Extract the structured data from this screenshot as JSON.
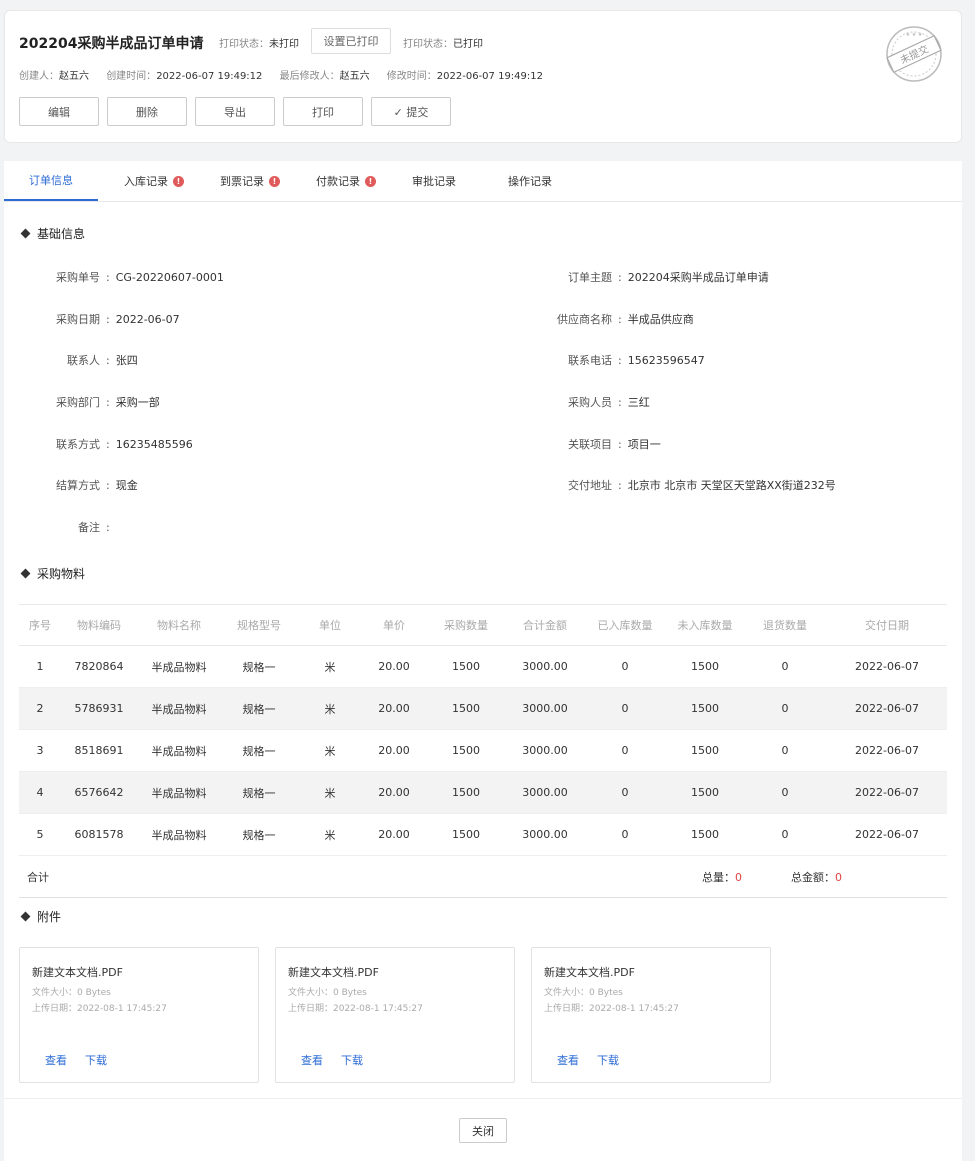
{
  "header": {
    "title": "202204采购半成品订单申请",
    "print_status_label_1": "打印状态：",
    "print_status_value_1": "未打印",
    "set_printed_button": "设置已打印",
    "print_status_label_2": "打印状态：",
    "print_status_value_2": "已打印",
    "creator_label": "创建人：",
    "creator": "赵五六",
    "created_time_label": "创建时间：",
    "created_time": "2022-06-07 19:49:12",
    "modifier_label": "最后修改人：",
    "modifier": "赵五六",
    "modified_time_label": "修改时间：",
    "modified_time": "2022-06-07 19:49:12",
    "actions": [
      "编辑",
      "删除",
      "导出",
      "打印",
      "✓ 提交"
    ],
    "stamp_text": "未提交"
  },
  "tabs": {
    "items": [
      {
        "label": "订单信息",
        "active": true,
        "badge": ""
      },
      {
        "label": "入库记录",
        "active": false,
        "badge": "!"
      },
      {
        "label": "到票记录",
        "active": false,
        "badge": "!"
      },
      {
        "label": "付款记录",
        "active": false,
        "badge": "!"
      },
      {
        "label": "审批记录",
        "active": false,
        "badge": ""
      },
      {
        "label": "操作记录",
        "active": false,
        "badge": ""
      }
    ]
  },
  "basic": {
    "section_title": "基础信息",
    "left": [
      {
        "label": "采购单号",
        "value": "CG-20220607-0001"
      },
      {
        "label": "采购日期",
        "value": "2022-06-07"
      },
      {
        "label": "联系人",
        "value": "张四"
      },
      {
        "label": "采购部门",
        "value": "采购一部"
      },
      {
        "label": "联系方式",
        "value": "16235485596"
      },
      {
        "label": "结算方式",
        "value": "现金"
      },
      {
        "label": "备注",
        "value": ""
      }
    ],
    "right": [
      {
        "label": "订单主题",
        "value": "202204采购半成品订单申请"
      },
      {
        "label": "供应商名称",
        "value": "半成品供应商"
      },
      {
        "label": "联系电话",
        "value": "15623596547"
      },
      {
        "label": "采购人员",
        "value": "三红"
      },
      {
        "label": "关联项目",
        "value": "项目一"
      },
      {
        "label": "交付地址",
        "value": "北京市 北京市 天堂区天堂路XX街道232号"
      }
    ]
  },
  "materials": {
    "section_title": "采购物料",
    "columns": [
      "序号",
      "物料编码",
      "物料名称",
      "规格型号",
      "单位",
      "单价",
      "采购数量",
      "合计金额",
      "已入库数量",
      "未入库数量",
      "退货数量",
      "交付日期"
    ],
    "rows": [
      [
        "1",
        "7820864",
        "半成品物料",
        "规格一",
        "米",
        "20.00",
        "1500",
        "3000.00",
        "0",
        "1500",
        "0",
        "2022-06-07"
      ],
      [
        "2",
        "5786931",
        "半成品物料",
        "规格一",
        "米",
        "20.00",
        "1500",
        "3000.00",
        "0",
        "1500",
        "0",
        "2022-06-07"
      ],
      [
        "3",
        "8518691",
        "半成品物料",
        "规格一",
        "米",
        "20.00",
        "1500",
        "3000.00",
        "0",
        "1500",
        "0",
        "2022-06-07"
      ],
      [
        "4",
        "6576642",
        "半成品物料",
        "规格一",
        "米",
        "20.00",
        "1500",
        "3000.00",
        "0",
        "1500",
        "0",
        "2022-06-07"
      ],
      [
        "5",
        "6081578",
        "半成品物料",
        "规格一",
        "米",
        "20.00",
        "1500",
        "3000.00",
        "0",
        "1500",
        "0",
        "2022-06-07"
      ]
    ],
    "total_label": "合计",
    "total_qty_label": "总量：",
    "total_qty": "0",
    "total_amount_label": "总金额：",
    "total_amount": "0"
  },
  "attachments": {
    "section_title": "附件",
    "items": [
      {
        "name": "新建文本文档.PDF",
        "size": "文件大小：0 Bytes",
        "date": "上传日期：2022-08-1 17:45:27",
        "view": "查看",
        "download": "下载"
      },
      {
        "name": "新建文本文档.PDF",
        "size": "文件大小：0 Bytes",
        "date": "上传日期：2022-08-1 17:45:27",
        "view": "查看",
        "download": "下载"
      },
      {
        "name": "新建文本文档.PDF",
        "size": "文件大小：0 Bytes",
        "date": "上传日期：2022-08-1 17:45:27",
        "view": "查看",
        "download": "下载"
      }
    ]
  },
  "footer": {
    "close_button": "关闭"
  },
  "colors": {
    "accent": "#2c6bd6",
    "badge": "#e05a5a",
    "total_red": "#e04444"
  }
}
